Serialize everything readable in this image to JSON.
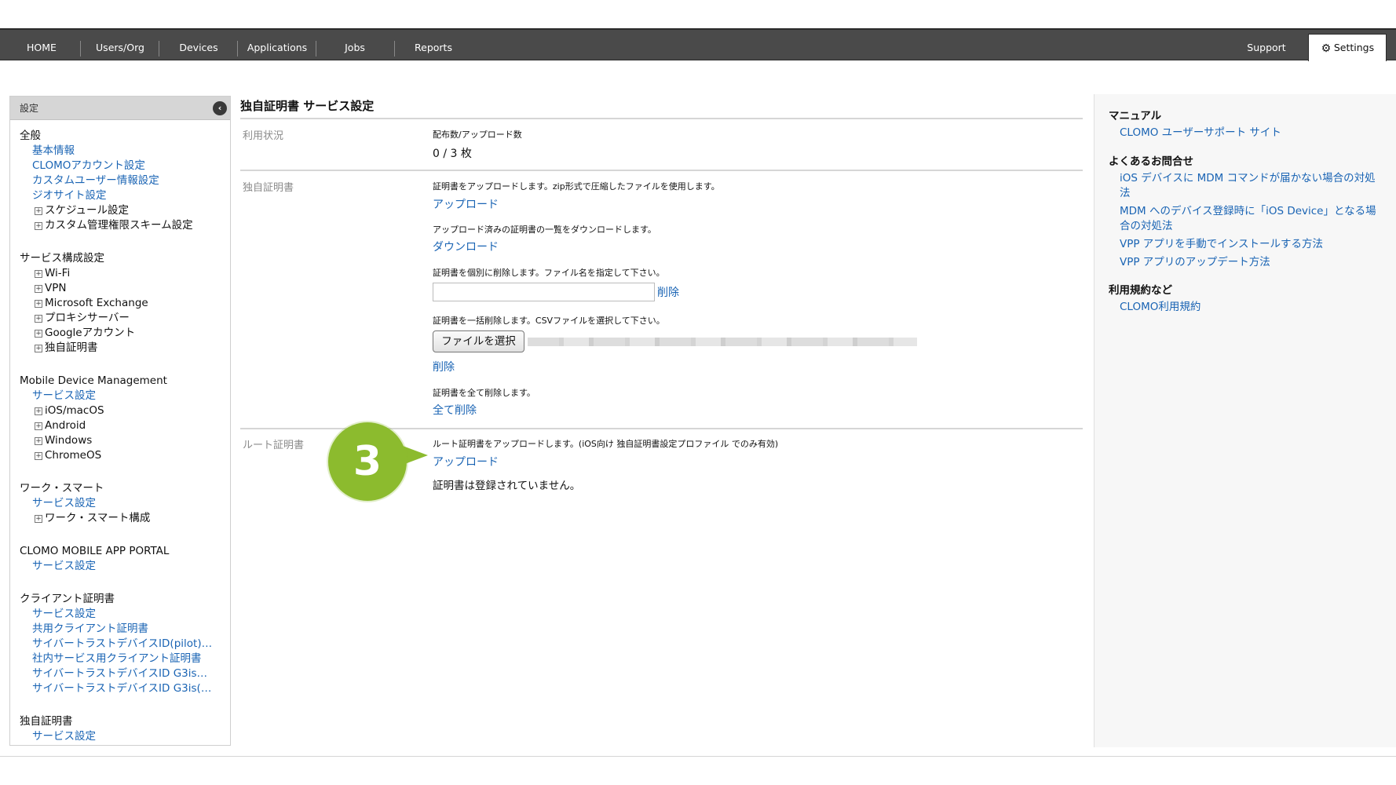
{
  "nav": {
    "items": [
      "HOME",
      "Users/Org",
      "Devices",
      "Applications",
      "Jobs",
      "Reports"
    ],
    "support": "Support",
    "settings": "Settings"
  },
  "sidebar": {
    "header": "設定",
    "general": {
      "title": "全般",
      "links": [
        "基本情報",
        "CLOMOアカウント設定",
        "カスタムユーザー情報設定",
        "ジオサイト設定"
      ],
      "trees": [
        "スケジュール設定",
        "カスタム管理権限スキーム設定"
      ]
    },
    "service": {
      "title": "サービス構成設定",
      "trees": [
        "Wi-Fi",
        "VPN",
        "Microsoft Exchange",
        "プロキシサーバー",
        "Googleアカウント",
        "独自証明書"
      ]
    },
    "mdm": {
      "title": "Mobile Device Management",
      "link": "サービス設定",
      "trees": [
        "iOS/macOS",
        "Android",
        "Windows",
        "ChromeOS"
      ]
    },
    "worksmart": {
      "title": "ワーク・スマート",
      "link": "サービス設定",
      "trees": [
        "ワーク・スマート構成"
      ]
    },
    "portal": {
      "title": "CLOMO MOBILE APP PORTAL",
      "link": "サービス設定"
    },
    "client_cert": {
      "title": "クライアント証明書",
      "links": [
        "サービス設定",
        "共用クライアント証明書",
        "サイバートラストデバイスID(pilot)…",
        "社内サービス用クライアント証明書",
        "サイバートラストデバイスID G3is…",
        "サイバートラストデバイスID G3is(…"
      ]
    },
    "own_cert": {
      "title": "独自証明書",
      "link": "サービス設定"
    }
  },
  "main": {
    "title": "独自証明書 サービス設定",
    "usage": {
      "label": "利用状況",
      "caption": "配布数/アップロード数",
      "value": "0 / 3 枚"
    },
    "cert": {
      "label": "独自証明書",
      "upload_desc": "証明書をアップロードします。zip形式で圧縮したファイルを使用します。",
      "upload_link": "アップロード",
      "download_desc": "アップロード済みの証明書の一覧をダウンロードします。",
      "download_link": "ダウンロード",
      "delete_one_desc": "証明書を個別に削除します。ファイル名を指定して下さい。",
      "delete_one_link": "削除",
      "delete_bulk_desc": "証明書を一括削除します。CSVファイルを選択して下さい。",
      "choose_file": "ファイルを選択",
      "delete_bulk_link": "削除",
      "delete_all_desc": "証明書を全て削除します。",
      "delete_all_link": "全て削除"
    },
    "root": {
      "label": "ルート証明書",
      "desc": "ルート証明書をアップロードします。(iOS向け 独自証明書設定プロファイル でのみ有効)",
      "upload_link": "アップロード",
      "status": "証明書は登録されていません。"
    },
    "step_badge": "3",
    "step_color": "#8cbb2e"
  },
  "right": {
    "manual_title": "マニュアル",
    "manual_link": "CLOMO ユーザーサポート サイト",
    "faq_title": "よくあるお問合せ",
    "faq_links": [
      "iOS デバイスに MDM コマンドが届かない場合の対処法",
      "MDM へのデバイス登録時に「iOS Device」となる場合の対処法",
      "VPP アプリを手動でインストールする方法",
      "VPP アプリのアップデート方法"
    ],
    "terms_title": "利用規約など",
    "terms_link": "CLOMO利用規約"
  }
}
